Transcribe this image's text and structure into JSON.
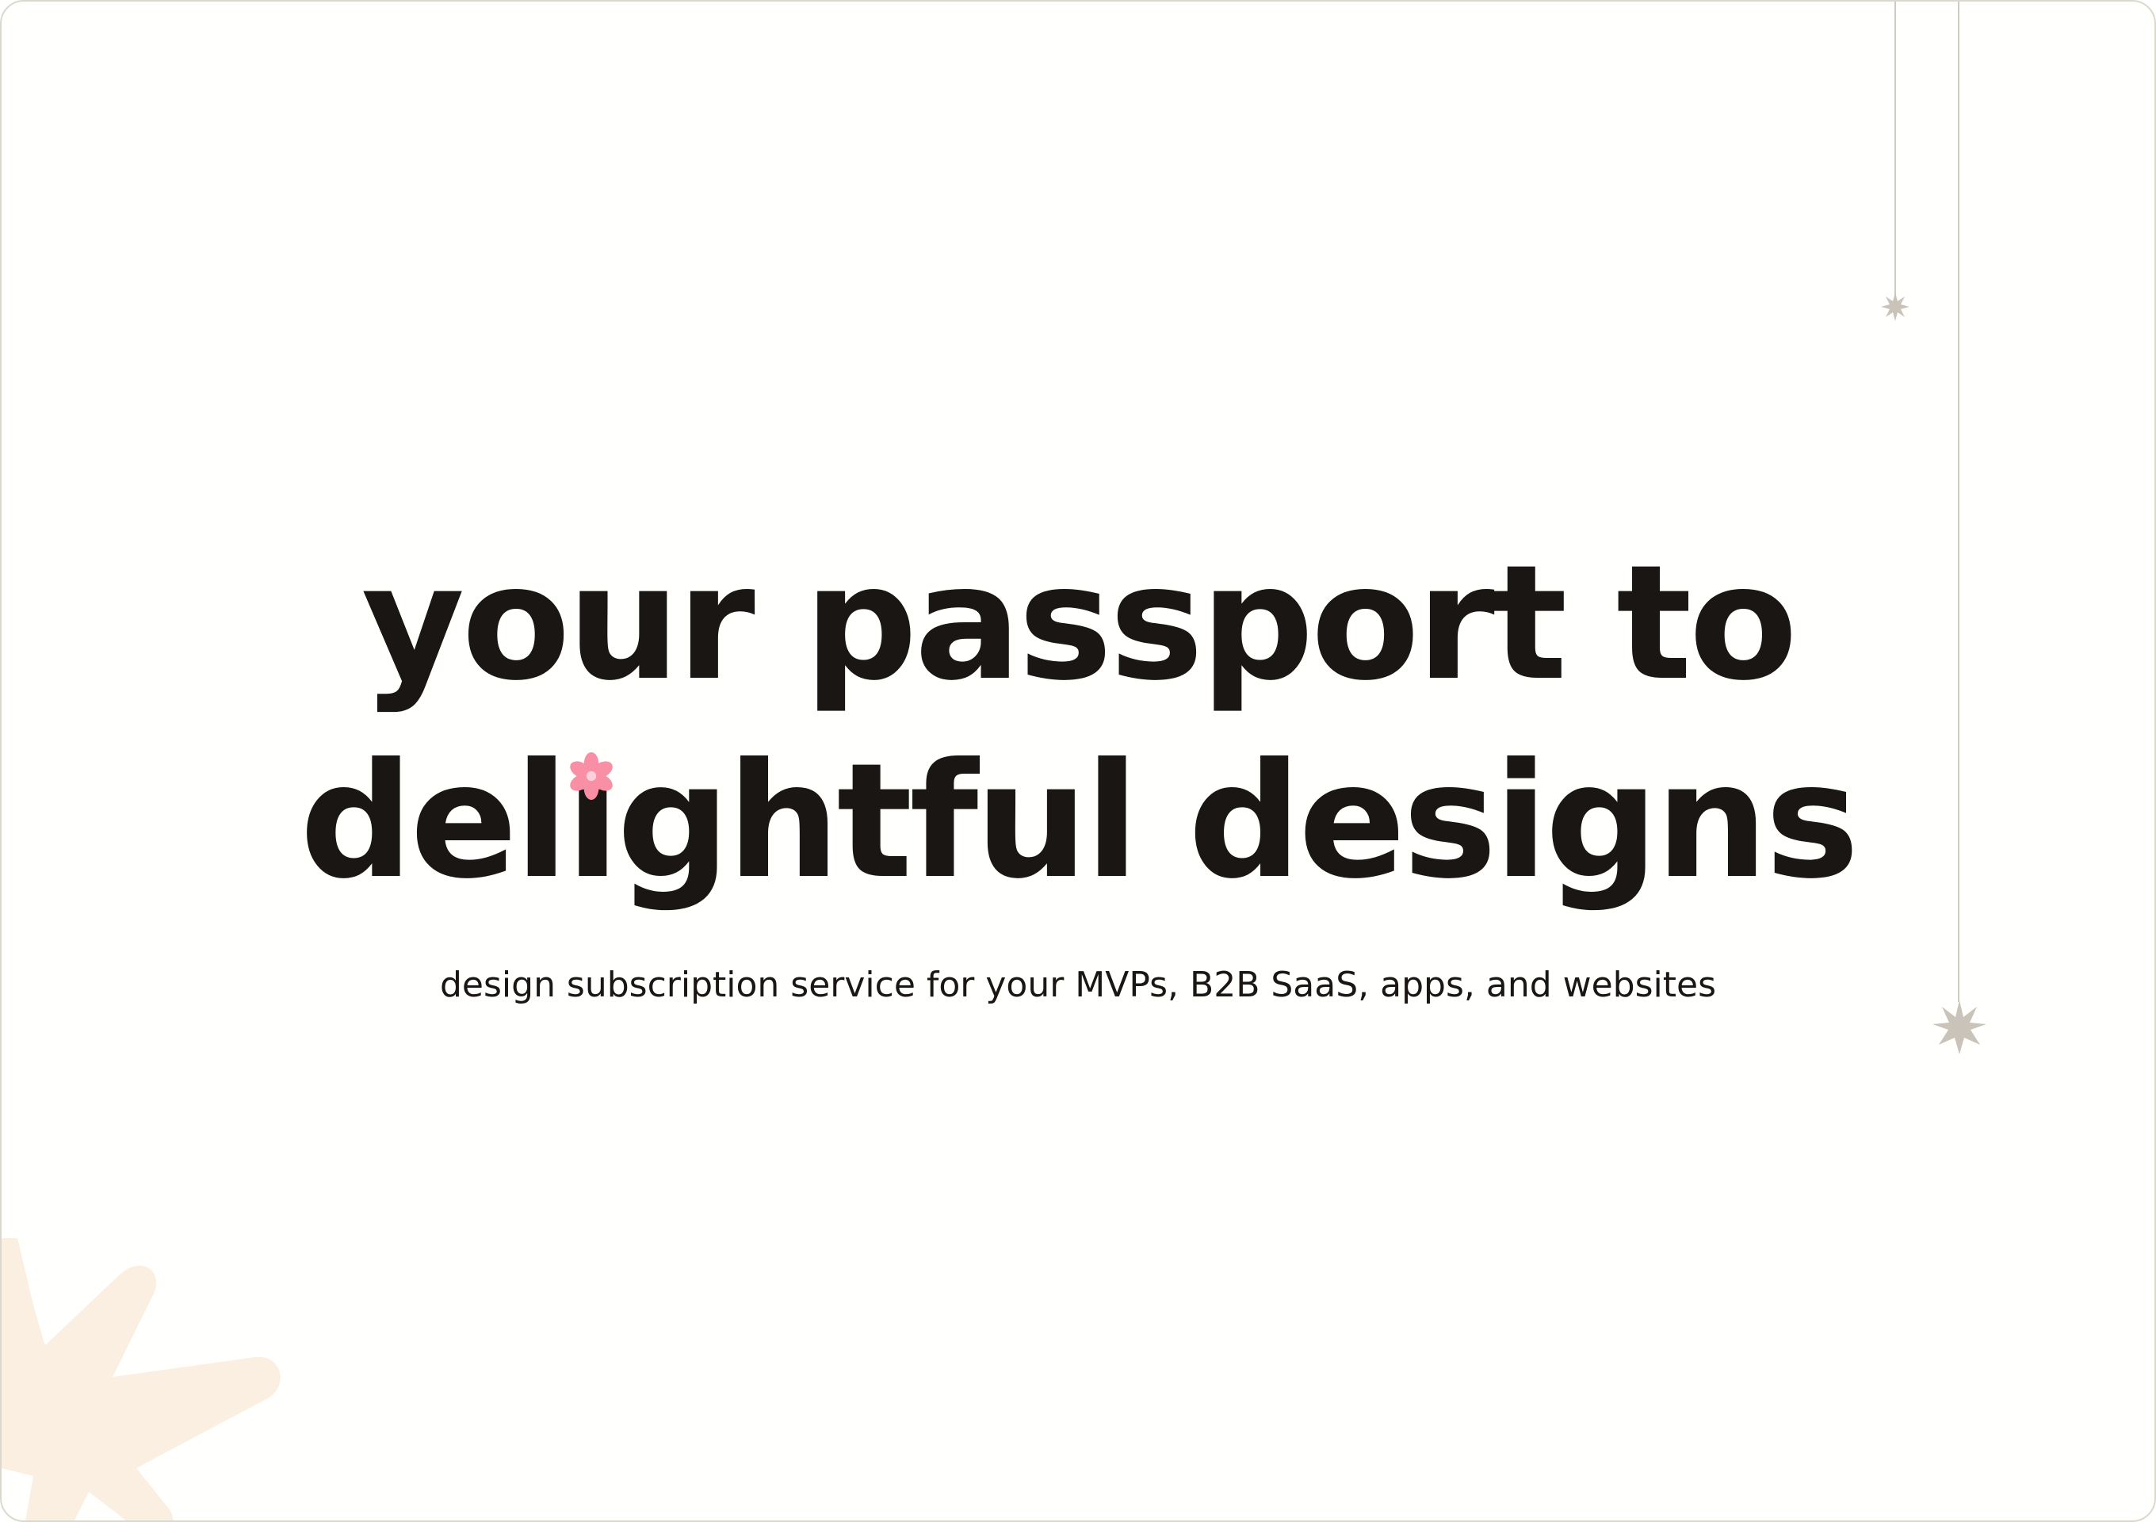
{
  "hero": {
    "line1": "your passport to",
    "line2_a": "del",
    "line2_i": "ı",
    "line2_b": "ghtful designs"
  },
  "subtitle": "design subscription service for your MVPs, B2B SaaS, apps, and websites",
  "icons": {
    "flower": "flower-icon",
    "hanging_star_small": "star-icon",
    "hanging_star_large": "star-icon",
    "corner_decoration": "starburst-icon"
  },
  "colors": {
    "text": "#1a1613",
    "flower": "#f98fa5",
    "star": "#c9c3ba",
    "corner": "#fbefe1",
    "border": "#dcd8cf"
  }
}
